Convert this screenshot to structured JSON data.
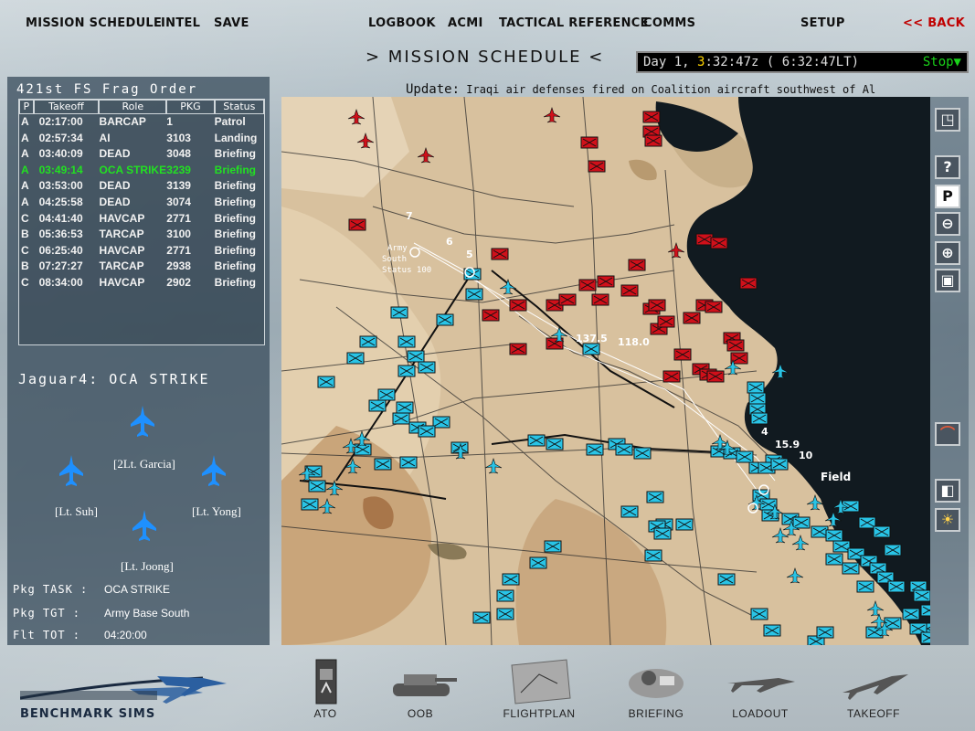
{
  "menu": {
    "mission_schedule": "MISSION SCHEDULE",
    "intel": "INTEL",
    "save": "SAVE",
    "logbook": "LOGBOOK",
    "acmi": "ACMI",
    "tactical_reference": "TACTICAL REFERENCE",
    "comms": "COMMS",
    "setup": "SETUP",
    "back": "<< BACK"
  },
  "screen_title": ">  MISSION SCHEDULE  <",
  "clock": {
    "day_label": "Day 1,",
    "hour": "3",
    "time_rest": ":32:47z",
    "local": "( 6:32:47LT)",
    "state": "Stop▼"
  },
  "update": {
    "label": "Update:",
    "text": "Iraqi air defenses fired on Coalition aircraft southwest of Al"
  },
  "frag_order": {
    "title": "421st FS Frag Order",
    "columns": [
      "P",
      "Takeoff",
      "Role",
      "PKG",
      "Status"
    ],
    "rows": [
      {
        "p": "A",
        "takeoff": "02:17:00",
        "role": "BARCAP",
        "pkg": "1",
        "status": "Patrol"
      },
      {
        "p": "A",
        "takeoff": "02:57:34",
        "role": "AI",
        "pkg": "3103",
        "status": "Landing"
      },
      {
        "p": "A",
        "takeoff": "03:40:09",
        "role": "DEAD",
        "pkg": "3048",
        "status": "Briefing"
      },
      {
        "p": "A",
        "takeoff": "03:49:14",
        "role": "OCA STRIKE",
        "pkg": "3239",
        "status": "Briefing",
        "selected": true
      },
      {
        "p": "A",
        "takeoff": "03:53:00",
        "role": "DEAD",
        "pkg": "3139",
        "status": "Briefing"
      },
      {
        "p": "A",
        "takeoff": "04:25:58",
        "role": "DEAD",
        "pkg": "3074",
        "status": "Briefing"
      },
      {
        "p": "C",
        "takeoff": "04:41:40",
        "role": "HAVCAP",
        "pkg": "2771",
        "status": "Briefing"
      },
      {
        "p": "B",
        "takeoff": "05:36:53",
        "role": "TARCAP",
        "pkg": "3100",
        "status": "Briefing"
      },
      {
        "p": "C",
        "takeoff": "06:25:40",
        "role": "HAVCAP",
        "pkg": "2771",
        "status": "Briefing"
      },
      {
        "p": "B",
        "takeoff": "07:27:27",
        "role": "TARCAP",
        "pkg": "2938",
        "status": "Briefing"
      },
      {
        "p": "C",
        "takeoff": "08:34:00",
        "role": "HAVCAP",
        "pkg": "2902",
        "status": "Briefing"
      }
    ]
  },
  "flight": {
    "name": "Jaguar4: OCA STRIKE",
    "pilots": [
      "[2Lt. Garcia]",
      "[Lt. Suh]",
      "[Lt. Yong]",
      "[Lt. Joong]"
    ]
  },
  "package": {
    "task_label": "Pkg TASK :",
    "task_value": "OCA STRIKE",
    "tgt_label": "Pkg TGT :",
    "tgt_value": "Army Base South",
    "tot_label": "Flt TOT :",
    "tot_value": "04:20:00"
  },
  "map": {
    "labels": {
      "army_base": "Army",
      "south": "South",
      "status": "Status 100",
      "field": "Field",
      "legs": [
        "137.5",
        "118.0",
        "15.9",
        "10",
        "4",
        "7",
        "6",
        "5"
      ]
    }
  },
  "toolbar": [
    "zoom-fit-icon",
    "help-icon",
    "p-icon",
    "zoom-out-icon",
    "zoom-in-icon",
    "center-icon",
    "threat-icon",
    "layer-icon",
    "weather-icon"
  ],
  "bottom_nav": {
    "logo": "BENCHMARK SIMS",
    "items": [
      "ATO",
      "OOB",
      "FLIGHTPLAN",
      "BRIEFING",
      "LOADOUT",
      "TAKEOFF"
    ]
  }
}
